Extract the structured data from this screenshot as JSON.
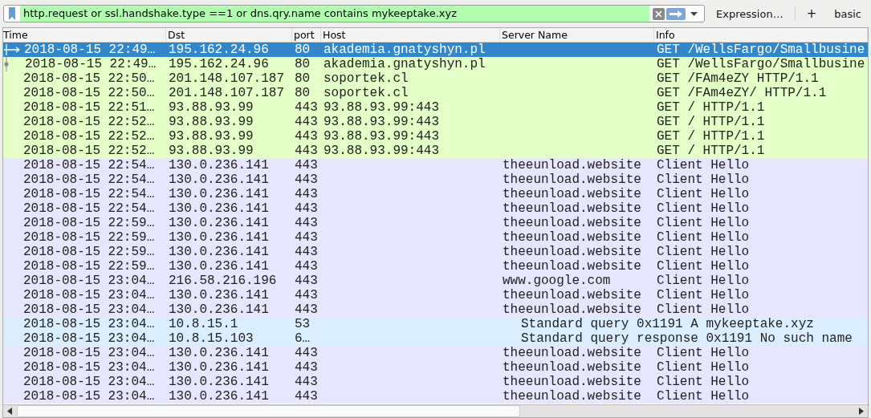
{
  "filter": {
    "value": "http.request or ssl.handshake.type ==1 or dns.qry.name contains mykeeptake.xyz",
    "valid": true
  },
  "toolbar": {
    "expression": "Expression…",
    "add": "+",
    "label": "basic"
  },
  "columns": [
    "Time",
    "Dst",
    "port",
    "Host",
    "Server Name",
    "Info"
  ],
  "rows": [
    {
      "kind": "http",
      "selected": true,
      "related": {
        "kind": "arrow"
      },
      "time": "2018-08-15 22:49…",
      "dst": "195.162.24.96",
      "port": "80",
      "host": "akademia.gnatyshyn.pl",
      "info": "GET /WellsFargo/Smallbusine"
    },
    {
      "kind": "http",
      "selected": false,
      "related": {
        "kind": "dot"
      },
      "time": "2018-08-15 22:49…",
      "dst": "195.162.24.96",
      "port": "80",
      "host": "akademia.gnatyshyn.pl",
      "info": "GET /WellsFargo/Smallbusine"
    },
    {
      "kind": "http",
      "selected": false,
      "time": "2018-08-15 22:50…",
      "dst": "201.148.107.187",
      "port": "80",
      "host": "soportek.cl",
      "info": "GET /FAm4eZY HTTP/1.1"
    },
    {
      "kind": "http",
      "selected": false,
      "time": "2018-08-15 22:50…",
      "dst": "201.148.107.187",
      "port": "80",
      "host": "soportek.cl",
      "info": "GET /FAm4eZY/ HTTP/1.1"
    },
    {
      "kind": "http",
      "selected": false,
      "time": "2018-08-15 22:51…",
      "dst": "93.88.93.99",
      "port": "443",
      "host": "93.88.93.99:443",
      "info": "GET / HTTP/1.1"
    },
    {
      "kind": "http",
      "selected": false,
      "time": "2018-08-15 22:52…",
      "dst": "93.88.93.99",
      "port": "443",
      "host": "93.88.93.99:443",
      "info": "GET / HTTP/1.1"
    },
    {
      "kind": "http",
      "selected": false,
      "time": "2018-08-15 22:52…",
      "dst": "93.88.93.99",
      "port": "443",
      "host": "93.88.93.99:443",
      "info": "GET / HTTP/1.1"
    },
    {
      "kind": "http",
      "selected": false,
      "time": "2018-08-15 22:52…",
      "dst": "93.88.93.99",
      "port": "443",
      "host": "93.88.93.99:443",
      "info": "GET / HTTP/1.1"
    },
    {
      "kind": "tls",
      "selected": false,
      "time": "2018-08-15 22:54…",
      "dst": "130.0.236.141",
      "port": "443",
      "server": "theeunload.website",
      "info": "Client Hello"
    },
    {
      "kind": "tls",
      "selected": false,
      "time": "2018-08-15 22:54…",
      "dst": "130.0.236.141",
      "port": "443",
      "server": "theeunload.website",
      "info": "Client Hello"
    },
    {
      "kind": "tls",
      "selected": false,
      "time": "2018-08-15 22:54…",
      "dst": "130.0.236.141",
      "port": "443",
      "server": "theeunload.website",
      "info": "Client Hello"
    },
    {
      "kind": "tls",
      "selected": false,
      "time": "2018-08-15 22:54…",
      "dst": "130.0.236.141",
      "port": "443",
      "server": "theeunload.website",
      "info": "Client Hello"
    },
    {
      "kind": "tls",
      "selected": false,
      "time": "2018-08-15 22:59…",
      "dst": "130.0.236.141",
      "port": "443",
      "server": "theeunload.website",
      "info": "Client Hello"
    },
    {
      "kind": "tls",
      "selected": false,
      "time": "2018-08-15 22:59…",
      "dst": "130.0.236.141",
      "port": "443",
      "server": "theeunload.website",
      "info": "Client Hello"
    },
    {
      "kind": "tls",
      "selected": false,
      "time": "2018-08-15 22:59…",
      "dst": "130.0.236.141",
      "port": "443",
      "server": "theeunload.website",
      "info": "Client Hello"
    },
    {
      "kind": "tls",
      "selected": false,
      "time": "2018-08-15 22:59…",
      "dst": "130.0.236.141",
      "port": "443",
      "server": "theeunload.website",
      "info": "Client Hello"
    },
    {
      "kind": "tls",
      "selected": false,
      "time": "2018-08-15 23:04…",
      "dst": "216.58.216.196",
      "port": "443",
      "server": "www.google.com",
      "info": "Client Hello"
    },
    {
      "kind": "tls",
      "selected": false,
      "time": "2018-08-15 23:04…",
      "dst": "130.0.236.141",
      "port": "443",
      "server": "theeunload.website",
      "info": "Client Hello"
    },
    {
      "kind": "tls",
      "selected": false,
      "time": "2018-08-15 23:04…",
      "dst": "130.0.236.141",
      "port": "443",
      "server": "theeunload.website",
      "info": "Client Hello"
    },
    {
      "kind": "dns",
      "selected": false,
      "time": "2018-08-15 23:04…",
      "dst": "10.8.15.1",
      "port": "53",
      "info": "Standard query 0x1191 A mykeeptake.xyz"
    },
    {
      "kind": "dns",
      "selected": false,
      "time": "2018-08-15 23:04…",
      "dst": "10.8.15.103",
      "port": "6…",
      "info": "Standard query response 0x1191 No such name"
    },
    {
      "kind": "tls",
      "selected": false,
      "time": "2018-08-15 23:04…",
      "dst": "130.0.236.141",
      "port": "443",
      "server": "theeunload.website",
      "info": "Client Hello"
    },
    {
      "kind": "tls",
      "selected": false,
      "time": "2018-08-15 23:04…",
      "dst": "130.0.236.141",
      "port": "443",
      "server": "theeunload.website",
      "info": "Client Hello"
    },
    {
      "kind": "tls",
      "selected": false,
      "time": "2018-08-15 23:04…",
      "dst": "130.0.236.141",
      "port": "443",
      "server": "theeunload.website",
      "info": "Client Hello"
    },
    {
      "kind": "tls",
      "selected": false,
      "time": "2018-08-15 23:04…",
      "dst": "130.0.236.141",
      "port": "443",
      "server": "theeunload.website",
      "info": "Client Hello"
    }
  ]
}
